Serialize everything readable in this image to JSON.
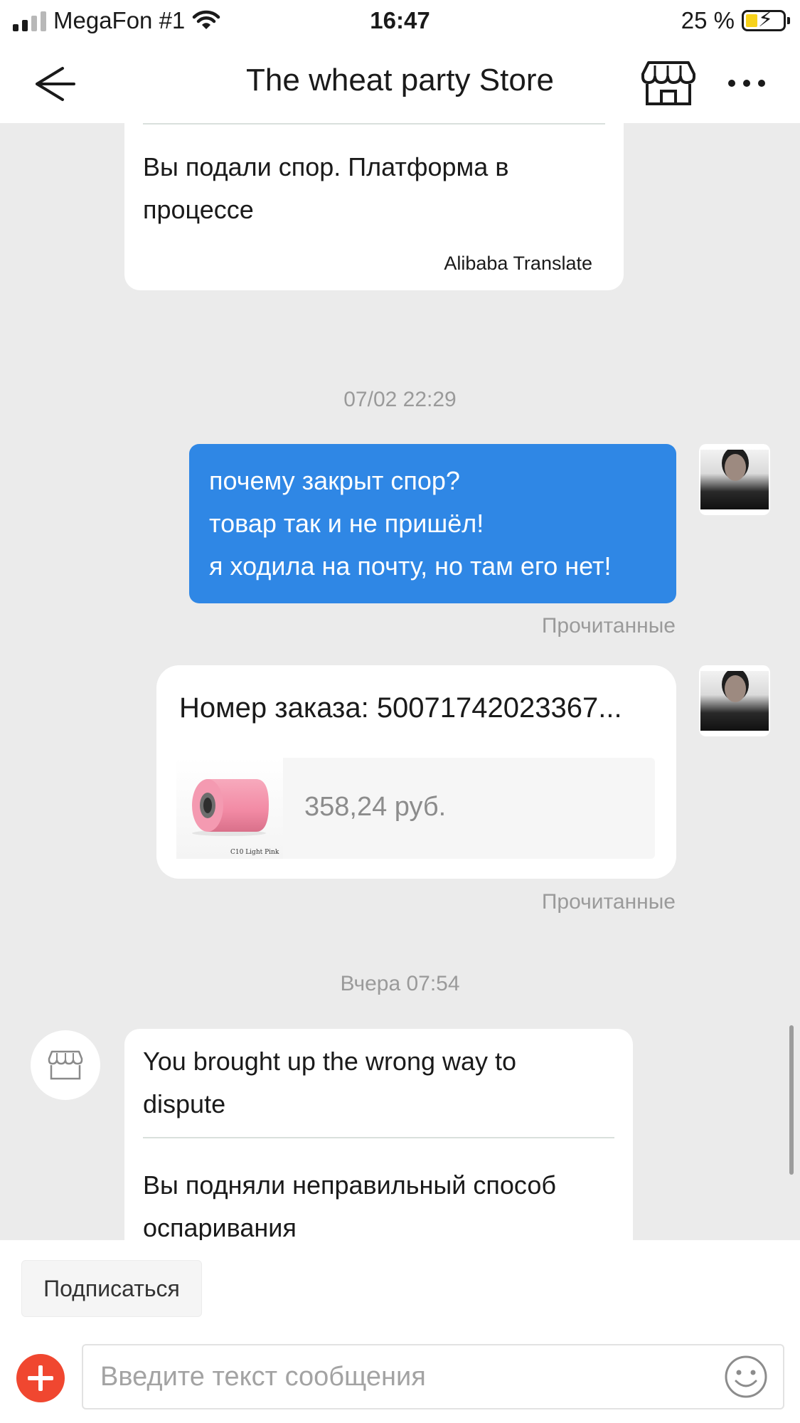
{
  "status_bar": {
    "carrier": "MegaFon #1",
    "time": "16:47",
    "battery": "25 %",
    "battery_level": 0.25
  },
  "header": {
    "title": "The wheat party Store",
    "back_icon": "arrow-left-icon",
    "store_icon": "storefront-icon",
    "more_icon": "more-horizontal-icon"
  },
  "messages": {
    "top": {
      "partial_text": "process",
      "translated_text": "Вы подали спор. Платформа в процессе",
      "translator": "Alibaba Translate"
    },
    "timestamp_1": "07/02 22:29",
    "user_message": {
      "lines": [
        "почему закрыт спор?",
        "товар так и не пришёл!",
        "я ходила на почту, но там его нет!"
      ],
      "status": "Прочитанные"
    },
    "order_card": {
      "order_label": "Номер заказа: 50071742023367...",
      "price": "358,24 руб.",
      "product_caption": "C10 Light Pink",
      "status": "Прочитанные"
    },
    "timestamp_2": "Вчера 07:54",
    "seller_message": {
      "text": "You brought up the wrong way to dispute",
      "translated_text": "Вы подняли неправильный способ оспаривания"
    }
  },
  "footer": {
    "subscribe_label": "Подписаться",
    "input_placeholder": "Введите текст сообщения",
    "add_icon": "plus-icon",
    "emoji_icon": "smiley-icon"
  },
  "colors": {
    "accent_blue": "#2f87e5",
    "plus_red": "#f04730",
    "chat_background": "#ebebeb"
  }
}
